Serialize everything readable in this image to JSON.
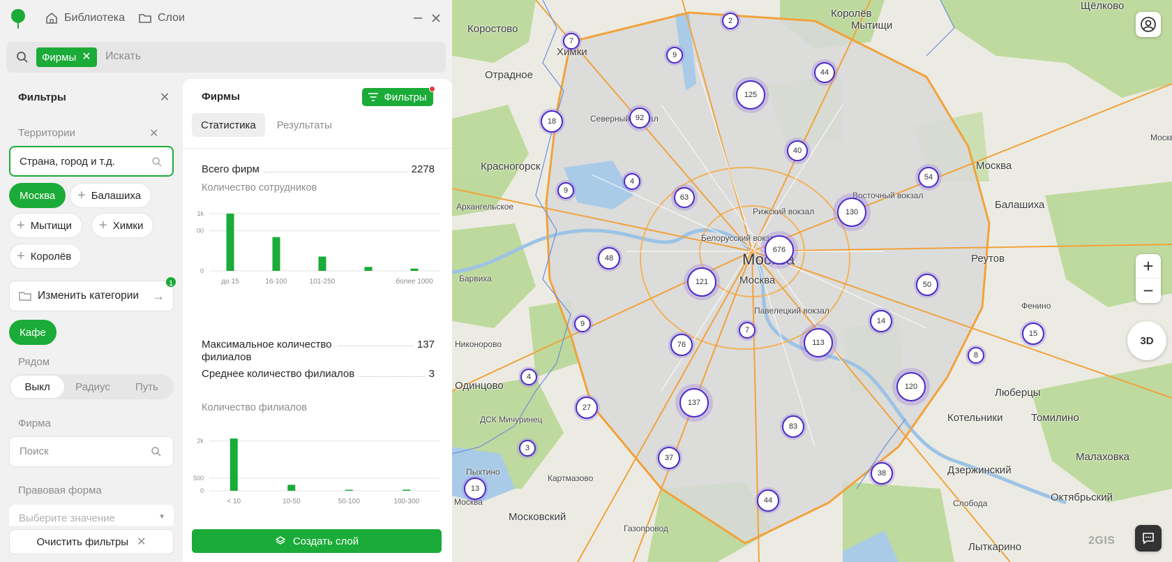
{
  "nav": {
    "library": "Библиотека",
    "layers": "Слои"
  },
  "search": {
    "chip": "Фирмы",
    "placeholder": "Искать"
  },
  "filters": {
    "title": "Фильтры",
    "territory_label": "Территории",
    "territory_placeholder": "Страна, город и т.д.",
    "cities": [
      {
        "label": "Москва",
        "active": true
      },
      {
        "label": "Балашиха",
        "active": false
      },
      {
        "label": "Мытищи",
        "active": false
      },
      {
        "label": "Химки",
        "active": false
      },
      {
        "label": "Королёв",
        "active": false
      }
    ],
    "categories_button": "Изменить категории",
    "categories_badge": "1",
    "category_chip": "Кафе",
    "nearby_label": "Рядом",
    "nearby_options": [
      "Выкл",
      "Радиус",
      "Путь"
    ],
    "firm_label": "Фирма",
    "firm_placeholder": "Поиск",
    "legal_label": "Правовая форма",
    "legal_placeholder": "Выберите значение",
    "clear_button": "Очистить фильтры"
  },
  "stats": {
    "title": "Фирмы",
    "filters_button": "Фильтры",
    "tabs": [
      "Статистика",
      "Результаты"
    ],
    "total_label": "Всего фирм",
    "total_value": "2278",
    "employees_label": "Количество сотрудников",
    "max_branches_label": "Максимальное количество филиалов",
    "max_branches_value": "137",
    "avg_branches_label": "Среднее количество филиалов",
    "avg_branches_value": "3",
    "branches_label": "Количество филиалов",
    "create_button": "Создать слой"
  },
  "chart_data": [
    {
      "type": "bar",
      "title": "Количество сотрудников",
      "categories": [
        "до 15",
        "16-100",
        "101-250",
        "",
        "более 1000"
      ],
      "values": [
        1000,
        590,
        250,
        70,
        40
      ],
      "y_ticks": [
        "0",
        "00",
        "1k"
      ],
      "ylim": [
        0,
        1000
      ]
    },
    {
      "type": "bar",
      "title": "Количество филиалов",
      "categories": [
        "< 10",
        "10-50",
        "50-100",
        "100-300"
      ],
      "values": [
        2100,
        240,
        40,
        45
      ],
      "y_ticks": [
        "0",
        "500",
        "2k"
      ],
      "ylim": [
        0,
        2300
      ]
    }
  ],
  "map": {
    "places": [
      "Королёв",
      "Мытищи",
      "Щёлково",
      "Коростово",
      "Химки",
      "Отрадное",
      "Северный вокзал",
      "Красногорск",
      "Архангельское",
      "Москва",
      "Балашиха",
      "Реутов",
      "Барвиха",
      "Москва",
      "Фенино",
      "Никонорово",
      "Одинцово",
      "ДСК Мичуринец",
      "Люберцы",
      "Котельники",
      "Томилино",
      "Лыткарино",
      "Дзержинский",
      "Малаховка",
      "Октябрьский",
      "Московский",
      "Картмазово",
      "Пыхтино",
      "Газопровод",
      "Слобода",
      "Москва",
      "Восточный вокзал",
      "Рижский вокзал",
      "Белорусский вокзал",
      "Павелецкий вокзал",
      "Москва",
      "Москва"
    ],
    "clusters": [
      "2",
      "7",
      "9",
      "44",
      "125",
      "18",
      "92",
      "40",
      "54",
      "9",
      "4",
      "63",
      "130",
      "676",
      "48",
      "121",
      "50",
      "9",
      "7",
      "14",
      "113",
      "76",
      "15",
      "8",
      "4",
      "137",
      "120",
      "27",
      "83",
      "3",
      "37",
      "38",
      "13",
      "44"
    ],
    "brand": "2GIS",
    "btn_3d": "3D"
  }
}
